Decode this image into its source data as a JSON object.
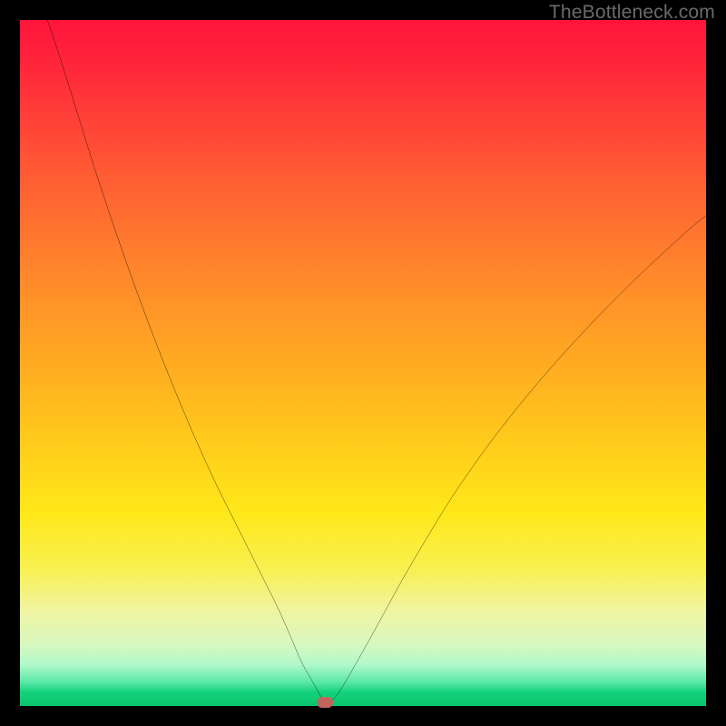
{
  "attribution": "TheBottleneck.com",
  "chart_data": {
    "type": "line",
    "title": "",
    "xlabel": "",
    "ylabel": "",
    "xlim": [
      0,
      100
    ],
    "ylim": [
      0,
      100
    ],
    "grid": false,
    "legend": false,
    "marker": {
      "x": 44.4,
      "y": 0.5,
      "color": "#c0645c"
    },
    "series": [
      {
        "name": "curve",
        "color": "#000000",
        "x": [
          4.0,
          6.0,
          8.5,
          11.0,
          14.0,
          17.0,
          20.0,
          23.0,
          26.0,
          29.0,
          32.0,
          35.0,
          37.5,
          39.5,
          41.0,
          42.5,
          43.8,
          44.5,
          45.3,
          46.5,
          48.0,
          50.0,
          52.5,
          55.5,
          59.0,
          63.0,
          67.5,
          72.5,
          78.0,
          84.0,
          90.5,
          97.0,
          100.0
        ],
        "y": [
          100.0,
          94.0,
          86.0,
          78.0,
          69.0,
          60.5,
          52.5,
          45.0,
          38.0,
          31.5,
          25.5,
          19.5,
          14.5,
          10.0,
          6.5,
          3.8,
          1.5,
          0.4,
          0.7,
          2.0,
          4.5,
          8.0,
          12.5,
          18.0,
          24.0,
          30.5,
          37.0,
          43.5,
          50.0,
          56.5,
          63.0,
          69.0,
          71.5
        ]
      }
    ]
  },
  "colors": {
    "frame": "#000000",
    "curve": "#000000",
    "attribution": "#6a6a6a",
    "gradient_top": "#ff143c",
    "gradient_bottom": "#0ac46c"
  }
}
